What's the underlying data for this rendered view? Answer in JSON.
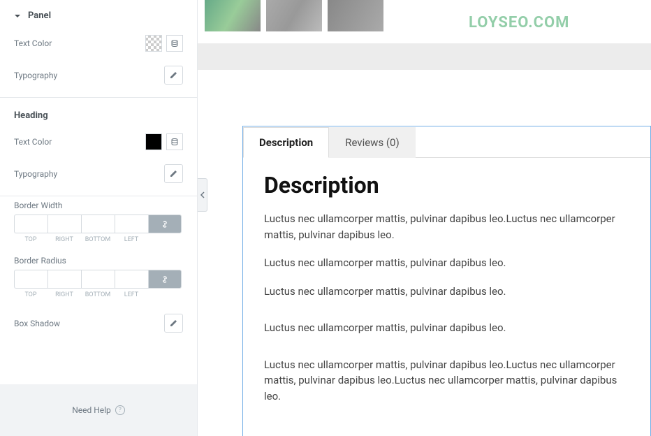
{
  "sidebar": {
    "panel_title": "Panel",
    "text_color_label": "Text Color",
    "typography_label": "Typography",
    "heading_section": "Heading",
    "border_width_label": "Border Width",
    "border_radius_label": "Border Radius",
    "box_shadow_label": "Box Shadow",
    "dim_sub": {
      "top": "TOP",
      "right": "RIGHT",
      "bottom": "BOTTOM",
      "left": "LEFT"
    },
    "need_help": "Need Help"
  },
  "watermark": "LOYSEO.COM",
  "tabs": {
    "description": "Description",
    "reviews": "Reviews (0)"
  },
  "content": {
    "heading": "Description",
    "p1": "Luctus nec ullamcorper mattis, pulvinar dapibus leo.Luctus nec ullamcorper mattis, pulvinar dapibus leo.",
    "p2": "Luctus nec ullamcorper mattis, pulvinar dapibus leo.",
    "p3": "Luctus nec ullamcorper mattis, pulvinar dapibus leo.",
    "p4": "Luctus nec ullamcorper mattis, pulvinar dapibus leo.",
    "p5": "Luctus nec ullamcorper mattis, pulvinar dapibus leo.Luctus nec ullamcorper mattis, pulvinar dapibus leo.Luctus nec ullamcorper mattis, pulvinar dapibus leo."
  }
}
